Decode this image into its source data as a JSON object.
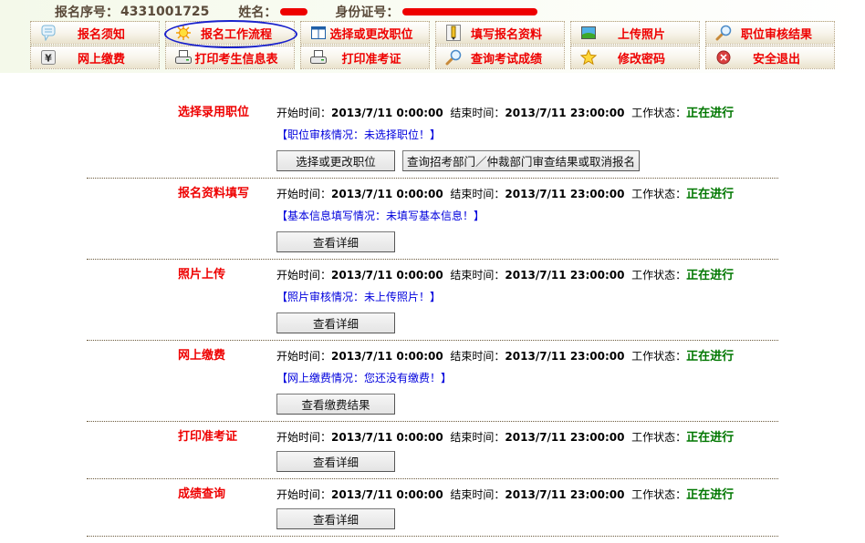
{
  "header": {
    "reg_no_label": "报名序号：",
    "reg_no_value": "4331001725",
    "name_label": "姓名：",
    "name_value_redacted": true,
    "id_label": "身份证号：",
    "id_value_redacted": true
  },
  "menu": {
    "items": [
      {
        "label": "报名须知",
        "icon": "speech-bubble-icon"
      },
      {
        "label": "报名工作流程",
        "icon": "sun-icon",
        "highlighted": true
      },
      {
        "label": "选择或更改职位",
        "icon": "window-icon"
      },
      {
        "label": "填写报名资料",
        "icon": "pencil-icon"
      },
      {
        "label": "上传照片",
        "icon": "landscape-photo-icon"
      },
      {
        "label": "职位审核结果",
        "icon": "magnifier-icon"
      },
      {
        "label": "网上缴费",
        "icon": "yuan-icon"
      },
      {
        "label": "打印考生信息表",
        "icon": "printer-icon"
      },
      {
        "label": "打印准考证",
        "icon": "printer-icon"
      },
      {
        "label": "查询考试成绩",
        "icon": "magnifier-icon"
      },
      {
        "label": "修改密码",
        "icon": "star-icon"
      },
      {
        "label": "安全退出",
        "icon": "exit-circle-icon"
      }
    ]
  },
  "labels": {
    "start": "开始时间：",
    "end": "结束时间：",
    "status": "工作状态："
  },
  "steps": [
    {
      "title": "选择录用职位",
      "start": "2013/7/11 0:00:00",
      "end": "2013/7/11 23:00:00",
      "status": "正在进行",
      "note": "【职位审核情况：未选择职位！】",
      "buttons": [
        "选择或更改职位",
        "查询招考部门／仲裁部门审查结果或取消报名"
      ]
    },
    {
      "title": "报名资料填写",
      "start": "2013/7/11 0:00:00",
      "end": "2013/7/11 23:00:00",
      "status": "正在进行",
      "note": "【基本信息填写情况：未填写基本信息！】",
      "buttons": [
        "查看详细"
      ]
    },
    {
      "title": "照片上传",
      "start": "2013/7/11 0:00:00",
      "end": "2013/7/11 23:00:00",
      "status": "正在进行",
      "note": "【照片审核情况：未上传照片！】",
      "buttons": [
        "查看详细"
      ]
    },
    {
      "title": "网上缴费",
      "start": "2013/7/11 0:00:00",
      "end": "2013/7/11 23:00:00",
      "status": "正在进行",
      "note": "【网上缴费情况：您还没有缴费！】",
      "buttons": [
        "查看缴费结果"
      ]
    },
    {
      "title": "打印准考证",
      "start": "2013/7/11 0:00:00",
      "end": "2013/7/11 23:00:00",
      "status": "正在进行",
      "note": null,
      "buttons": [
        "查看详细"
      ]
    },
    {
      "title": "成绩查询",
      "start": "2013/7/11 0:00:00",
      "end": "2013/7/11 23:00:00",
      "status": "正在进行",
      "note": null,
      "buttons": [
        "查看详细"
      ]
    }
  ],
  "colors": {
    "menu_text": "#ee0000",
    "step_title": "#ee0000",
    "status_active": "#007700",
    "note_text": "#0000dd",
    "highlight_ellipse": "#1a22cc"
  }
}
